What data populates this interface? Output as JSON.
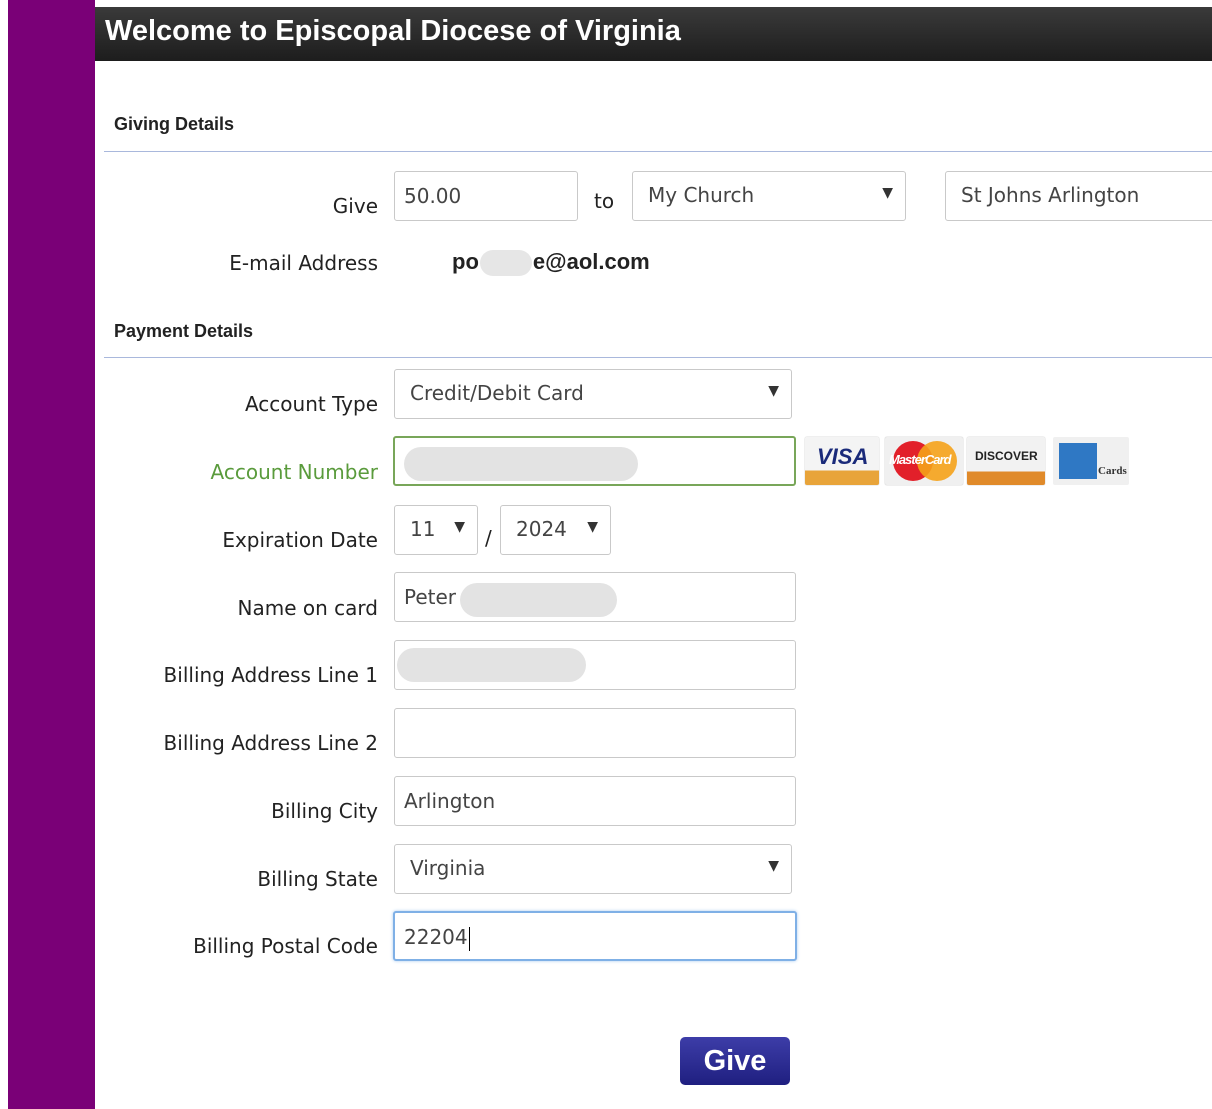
{
  "header": {
    "title": "Welcome to Episcopal Diocese of Virginia"
  },
  "giving": {
    "section_title": "Giving Details",
    "give_label": "Give",
    "amount": "50.00",
    "to_label": "to",
    "recipient_type": "My Church",
    "church": "St Johns Arlington",
    "email_label": "E-mail Address",
    "email_prefix": "po",
    "email_suffix": "e@aol.com"
  },
  "payment": {
    "section_title": "Payment Details",
    "account_type_label": "Account Type",
    "account_type": "Credit/Debit Card",
    "account_number_label": "Account Number",
    "account_number_value": "",
    "expiration_label": "Expiration Date",
    "exp_month": "11",
    "exp_separator": "/",
    "exp_year": "2024",
    "name_label": "Name on card",
    "name_value": "Peter",
    "address1_label": "Billing Address Line 1",
    "address1_value": "",
    "address2_label": "Billing Address Line 2",
    "address2_value": "",
    "city_label": "Billing City",
    "city_value": "Arlington",
    "state_label": "Billing State",
    "state_value": "Virginia",
    "postal_label": "Billing Postal Code",
    "postal_value": "22204",
    "card_logos": [
      "VISA",
      "MasterCard",
      "DISCOVER",
      "Cards"
    ]
  },
  "actions": {
    "give_button": "Give"
  },
  "colors": {
    "sidebar": "#7a0077",
    "header": "#2a2a2a",
    "button": "#2b2b90",
    "valid_border": "#78a659",
    "focus_border": "#7fb0e6"
  }
}
